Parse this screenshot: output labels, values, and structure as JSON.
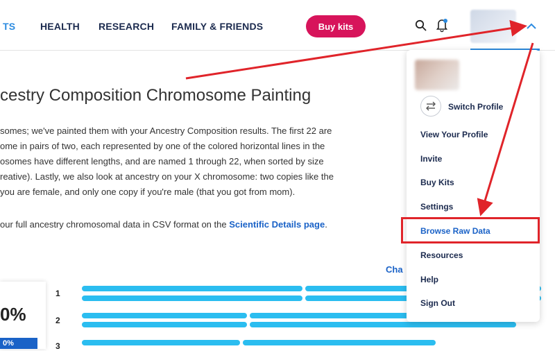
{
  "nav": {
    "items": [
      "TS",
      "HEALTH",
      "RESEARCH",
      "FAMILY & FRIENDS"
    ],
    "buy_kits": "Buy kits",
    "icons": [
      "search-icon",
      "notification-bell-icon",
      "chevron-up-icon"
    ]
  },
  "page": {
    "title": "cestry Composition Chromosome Painting",
    "paragraph_lines": [
      "somes; we've painted them with your Ancestry Composition results. The first 22 are",
      "ome in pairs of two, each represented by one of the colored horizontal lines in the",
      "osomes have different lengths, and are named 1 through 22, when sorted by size",
      "reative). Lastly, we also look at ancestry on your X chromosome: two copies like the",
      "you are female, and only one copy if you're male (that you got from mom)."
    ],
    "csv_prefix": "our full ancestry chromosomal data in CSV format on the ",
    "csv_link": "Scientific Details page",
    "csv_suffix": ".",
    "change_link": "Cha",
    "percent": "0%",
    "percent_badge": "0%",
    "chromosome_labels": [
      "1",
      "2",
      "3"
    ],
    "bar_color": "#2bbdf0"
  },
  "dropdown": {
    "switch_profile": "Switch Profile",
    "items": [
      "View Your Profile",
      "Invite",
      "Buy Kits",
      "Settings",
      "Browse Raw Data",
      "Resources",
      "Help",
      "Sign Out"
    ],
    "highlighted": "Browse Raw Data"
  },
  "annotation_color": "#e0242a"
}
